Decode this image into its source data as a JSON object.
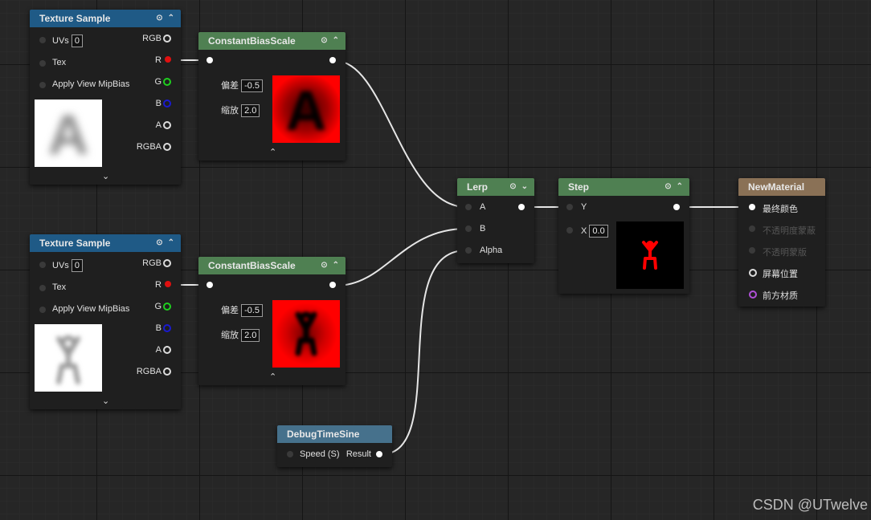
{
  "texture_sample_1": {
    "title": "Texture Sample",
    "inputs": [
      "UVs",
      "Tex",
      "Apply View MipBias"
    ],
    "uvs_value": "0",
    "outputs": [
      "RGB",
      "R",
      "G",
      "B",
      "A",
      "RGBA"
    ],
    "preview_letter": "A"
  },
  "texture_sample_2": {
    "title": "Texture Sample",
    "inputs": [
      "UVs",
      "Tex",
      "Apply View MipBias"
    ],
    "uvs_value": "0",
    "outputs": [
      "RGB",
      "R",
      "G",
      "B",
      "A",
      "RGBA"
    ]
  },
  "cbs_1": {
    "title": "ConstantBiasScale",
    "bias_label": "偏差",
    "bias_value": "-0.5",
    "scale_label": "缩放",
    "scale_value": "2.0",
    "preview_letter": "A"
  },
  "cbs_2": {
    "title": "ConstantBiasScale",
    "bias_label": "偏差",
    "bias_value": "-0.5",
    "scale_label": "缩放",
    "scale_value": "2.0"
  },
  "lerp": {
    "title": "Lerp",
    "inputs": [
      "A",
      "B",
      "Alpha"
    ]
  },
  "step": {
    "title": "Step",
    "input_y": "Y",
    "input_x": "X",
    "x_value": "0.0"
  },
  "material": {
    "title": "NewMaterial",
    "pins": [
      "最终颜色",
      "不透明度蒙蔽",
      "不透明蒙版",
      "屏幕位置",
      "前方材质"
    ]
  },
  "debug": {
    "title": "DebugTimeSine",
    "input": "Speed (S)",
    "output": "Result"
  },
  "watermark": "CSDN @UTwelve",
  "colors": {
    "texture_header": "#1f5a86",
    "math_header": "#4f8052",
    "material_header": "#8a7156",
    "debug_header": "#46718c",
    "red_pin": "#e01010",
    "green_pin": "#1fd01f",
    "blue_pin": "#1a1ad0",
    "preview_red": "#ff0000"
  }
}
